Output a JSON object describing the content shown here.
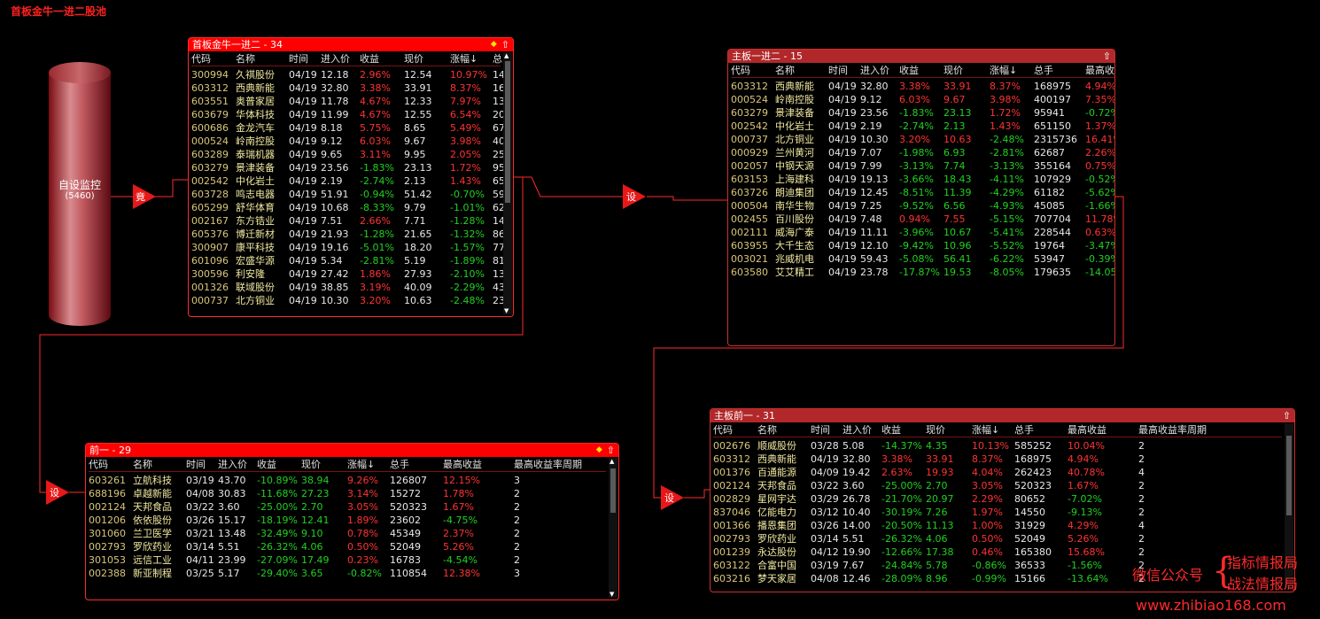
{
  "app_title": "首板金牛一进二股池",
  "source_node": {
    "label": "自设监控",
    "count": "(5460)"
  },
  "nodes": {
    "jing": "竟",
    "she": "设"
  },
  "watermark": {
    "prefix": "微信公众号",
    "line1": "指标情报局",
    "line2": "战法情报局",
    "url": "www.zhibiao168.com"
  },
  "colors": {
    "accent": "#ff0000",
    "up": "#ff3333",
    "down": "#22d022",
    "code": "#d8c67a"
  },
  "panel1": {
    "title": "首板金牛一进二 - 34",
    "headers": [
      "代码",
      "名称",
      "时间",
      "进入价",
      "收益",
      "现价",
      "涨幅↓",
      "总"
    ],
    "rows": [
      [
        "300994",
        "久祺股份",
        "04/19",
        "12.18",
        "2.96%",
        "12.54",
        "10.97%",
        "14"
      ],
      [
        "603312",
        "西典新能",
        "04/19",
        "32.80",
        "3.38%",
        "33.91",
        "8.37%",
        "16"
      ],
      [
        "603551",
        "奥普家居",
        "04/19",
        "11.78",
        "4.67%",
        "12.33",
        "7.97%",
        "13"
      ],
      [
        "603679",
        "华体科技",
        "04/19",
        "11.99",
        "4.67%",
        "12.55",
        "6.54%",
        "20"
      ],
      [
        "600686",
        "金龙汽车",
        "04/19",
        "8.18",
        "5.75%",
        "8.65",
        "5.49%",
        "67"
      ],
      [
        "000524",
        "岭南控股",
        "04/19",
        "9.12",
        "6.03%",
        "9.67",
        "3.98%",
        "40"
      ],
      [
        "603289",
        "泰瑞机器",
        "04/19",
        "9.65",
        "3.11%",
        "9.95",
        "2.05%",
        "25"
      ],
      [
        "603279",
        "景津装备",
        "04/19",
        "23.56",
        "-1.83%",
        "23.13",
        "1.72%",
        "95"
      ],
      [
        "002542",
        "中化岩土",
        "04/19",
        "2.19",
        "-2.74%",
        "2.13",
        "1.43%",
        "65"
      ],
      [
        "603728",
        "鸣志电器",
        "04/19",
        "51.91",
        "-0.94%",
        "51.42",
        "-0.70%",
        "59"
      ],
      [
        "605299",
        "舒华体育",
        "04/19",
        "10.68",
        "-8.33%",
        "9.79",
        "-1.01%",
        "62"
      ],
      [
        "002167",
        "东方锆业",
        "04/19",
        "7.51",
        "2.66%",
        "7.71",
        "-1.28%",
        "14"
      ],
      [
        "605376",
        "博迁新材",
        "04/19",
        "21.93",
        "-1.28%",
        "21.65",
        "-1.32%",
        "86"
      ],
      [
        "300907",
        "康平科技",
        "04/19",
        "19.16",
        "-5.01%",
        "18.20",
        "-1.57%",
        "77"
      ],
      [
        "601096",
        "宏盛华源",
        "04/19",
        "5.34",
        "-2.81%",
        "5.19",
        "-1.89%",
        "81"
      ],
      [
        "300596",
        "利安隆",
        "04/19",
        "27.42",
        "1.86%",
        "27.93",
        "-2.10%",
        "13"
      ],
      [
        "001326",
        "联域股份",
        "04/19",
        "38.85",
        "3.19%",
        "40.09",
        "-2.29%",
        "43"
      ],
      [
        "000737",
        "北方铜业",
        "04/19",
        "10.30",
        "3.20%",
        "10.63",
        "-2.48%",
        "23"
      ]
    ]
  },
  "panel2": {
    "title": "主板一进二 - 15",
    "headers": [
      "代码",
      "名称",
      "时间",
      "进入价",
      "收益",
      "现价",
      "涨幅↓",
      "总手",
      "最高收"
    ],
    "rows": [
      [
        "603312",
        "西典新能",
        "04/19",
        "32.80",
        "3.38%",
        "33.91",
        "8.37%",
        "168975",
        "4.94%"
      ],
      [
        "000524",
        "岭南控股",
        "04/19",
        "9.12",
        "6.03%",
        "9.67",
        "3.98%",
        "400197",
        "7.35%"
      ],
      [
        "603279",
        "景津装备",
        "04/19",
        "23.56",
        "-1.83%",
        "23.13",
        "1.72%",
        "95941",
        "-0.72%"
      ],
      [
        "002542",
        "中化岩土",
        "04/19",
        "2.19",
        "-2.74%",
        "2.13",
        "1.43%",
        "651150",
        "1.37%"
      ],
      [
        "000737",
        "北方铜业",
        "04/19",
        "10.30",
        "3.20%",
        "10.63",
        "-2.48%",
        "2315736",
        "16.41%"
      ],
      [
        "000929",
        "兰州黄河",
        "04/19",
        "7.07",
        "-1.98%",
        "6.93",
        "-2.81%",
        "62687",
        "2.26%"
      ],
      [
        "002057",
        "中钢天源",
        "04/19",
        "7.99",
        "-3.13%",
        "7.74",
        "-3.13%",
        "355164",
        "0.75%"
      ],
      [
        "603153",
        "上海建科",
        "04/19",
        "19.13",
        "-3.66%",
        "18.43",
        "-4.11%",
        "107929",
        "-0.52%"
      ],
      [
        "603726",
        "朗迪集团",
        "04/19",
        "12.45",
        "-8.51%",
        "11.39",
        "-4.29%",
        "61182",
        "-5.62%"
      ],
      [
        "000504",
        "南华生物",
        "04/19",
        "7.25",
        "-9.52%",
        "6.56",
        "-4.93%",
        "45085",
        "-1.66%"
      ],
      [
        "002455",
        "百川股份",
        "04/19",
        "7.48",
        "0.94%",
        "7.55",
        "-5.15%",
        "707704",
        "11.78%"
      ],
      [
        "002111",
        "威海广泰",
        "04/19",
        "11.11",
        "-3.96%",
        "10.67",
        "-5.41%",
        "228544",
        "0.63%"
      ],
      [
        "603955",
        "大千生态",
        "04/19",
        "12.10",
        "-9.42%",
        "10.96",
        "-5.52%",
        "19764",
        "-3.47%"
      ],
      [
        "003021",
        "兆威机电",
        "04/19",
        "59.43",
        "-5.08%",
        "56.41",
        "-6.22%",
        "53947",
        "-0.39%"
      ],
      [
        "603580",
        "艾艾精工",
        "04/19",
        "23.78",
        "-17.87%",
        "19.53",
        "-8.05%",
        "179635",
        "-14.05"
      ]
    ]
  },
  "panel3": {
    "title": "前一 - 29",
    "headers": [
      "代码",
      "名称",
      "时间",
      "进入价",
      "收益",
      "现价",
      "涨幅↓",
      "总手",
      "最高收益",
      "最高收益率周期"
    ],
    "rows": [
      [
        "603261",
        "立航科技",
        "03/19",
        "43.70",
        "-10.89%",
        "38.94",
        "9.26%",
        "126807",
        "12.15%",
        "3"
      ],
      [
        "688196",
        "卓越新能",
        "04/08",
        "30.83",
        "-11.68%",
        "27.23",
        "3.14%",
        "15272",
        "1.78%",
        "2"
      ],
      [
        "002124",
        "天邦食品",
        "03/22",
        "3.60",
        "-25.00%",
        "2.70",
        "3.05%",
        "520323",
        "1.67%",
        "2"
      ],
      [
        "001206",
        "依依股份",
        "03/26",
        "15.17",
        "-18.19%",
        "12.41",
        "1.89%",
        "23602",
        "-4.75%",
        "2"
      ],
      [
        "301060",
        "兰卫医学",
        "03/21",
        "13.48",
        "-32.49%",
        "9.10",
        "0.78%",
        "45349",
        "2.37%",
        "2"
      ],
      [
        "002793",
        "罗欣药业",
        "03/14",
        "5.51",
        "-26.32%",
        "4.06",
        "0.50%",
        "52049",
        "5.26%",
        "2"
      ],
      [
        "301053",
        "远信工业",
        "04/11",
        "23.99",
        "-27.09%",
        "17.49",
        "0.23%",
        "16783",
        "-4.54%",
        "2"
      ],
      [
        "002388",
        "新亚制程",
        "03/25",
        "5.17",
        "-29.40%",
        "3.65",
        "-0.82%",
        "110854",
        "12.38%",
        "3"
      ]
    ]
  },
  "panel4": {
    "title": "主板前一 - 31",
    "headers": [
      "代码",
      "名称",
      "时间",
      "进入价",
      "收益",
      "现价",
      "涨幅↓",
      "总手",
      "最高收益",
      "最高收益率周期"
    ],
    "rows": [
      [
        "002676",
        "顺威股份",
        "03/28",
        "5.08",
        "-14.37%",
        "4.35",
        "10.13%",
        "585252",
        "10.04%",
        "2"
      ],
      [
        "603312",
        "西典新能",
        "04/19",
        "32.80",
        "3.38%",
        "33.91",
        "8.37%",
        "168975",
        "4.94%",
        "2"
      ],
      [
        "001376",
        "百通能源",
        "04/09",
        "19.42",
        "2.63%",
        "19.93",
        "4.04%",
        "262423",
        "40.78%",
        "4"
      ],
      [
        "002124",
        "天邦食品",
        "03/22",
        "3.60",
        "-25.00%",
        "2.70",
        "3.05%",
        "520323",
        "1.67%",
        "2"
      ],
      [
        "002829",
        "星网宇达",
        "03/29",
        "26.78",
        "-21.70%",
        "20.97",
        "2.29%",
        "80652",
        "-7.02%",
        "2"
      ],
      [
        "837046",
        "亿能电力",
        "03/12",
        "10.40",
        "-30.19%",
        "7.26",
        "1.97%",
        "14550",
        "-9.13%",
        "2"
      ],
      [
        "001366",
        "播恩集团",
        "03/26",
        "14.00",
        "-20.50%",
        "11.13",
        "1.00%",
        "31929",
        "4.29%",
        "4"
      ],
      [
        "002793",
        "罗欣药业",
        "03/14",
        "5.51",
        "-26.32%",
        "4.06",
        "0.50%",
        "52049",
        "5.26%",
        "2"
      ],
      [
        "001239",
        "永达股份",
        "04/12",
        "19.90",
        "-12.66%",
        "17.38",
        "0.46%",
        "165380",
        "15.68%",
        "2"
      ],
      [
        "603122",
        "合富中国",
        "03/19",
        "7.67",
        "-24.84%",
        "5.78",
        "-0.86%",
        "36533",
        "-1.56%",
        "2"
      ],
      [
        "603216",
        "梦天家居",
        "04/08",
        "12.46",
        "-28.09%",
        "8.96",
        "-0.99%",
        "15166",
        "-13.64%",
        "2"
      ]
    ]
  }
}
